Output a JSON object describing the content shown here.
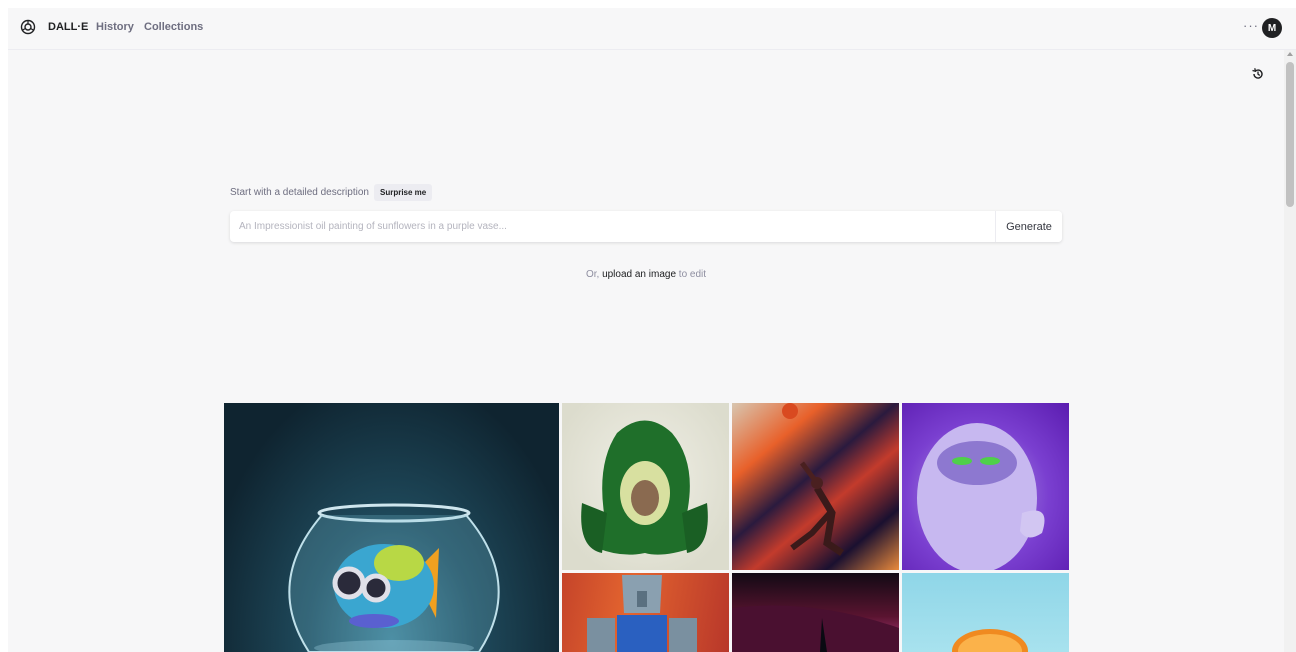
{
  "header": {
    "brand": "DALL·E",
    "nav": [
      {
        "label": "History"
      },
      {
        "label": "Collections"
      }
    ],
    "more_label": "···",
    "avatar_initial": "M"
  },
  "prompt": {
    "label": "Start with a detailed description",
    "surprise_label": "Surprise me",
    "placeholder": "An Impressionist oil painting of sunflowers in a purple vase...",
    "generate_label": "Generate"
  },
  "upload": {
    "prefix": "Or,",
    "link_label": "upload an image",
    "suffix": "to edit"
  },
  "gallery": {
    "tiles": [
      {
        "subject": "fish-in-bowl"
      },
      {
        "subject": "avocado-chair"
      },
      {
        "subject": "space-basketball"
      },
      {
        "subject": "purple-yeti"
      },
      {
        "subject": "robot-painting"
      },
      {
        "subject": "dark-landscape"
      },
      {
        "subject": "orange-slice"
      }
    ]
  },
  "colors": {
    "background": "#f7f7f8",
    "text": "#202123",
    "muted": "#6e6e80",
    "border": "#ececf1"
  }
}
